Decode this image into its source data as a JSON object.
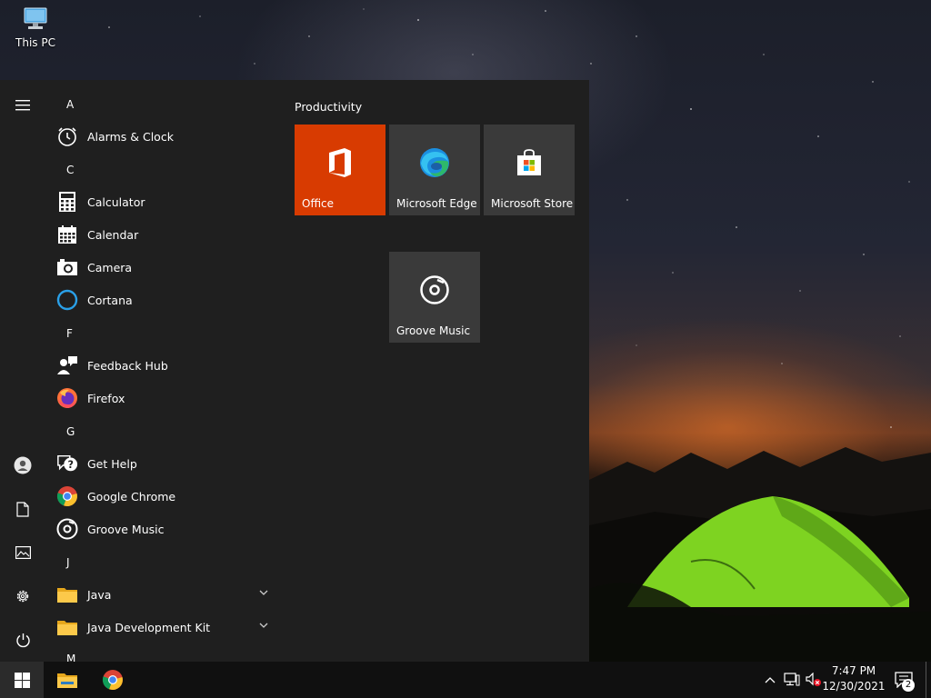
{
  "desktop": {
    "icons": [
      {
        "label": "This PC",
        "icon": "computer-icon"
      }
    ]
  },
  "start_menu": {
    "rail": [
      {
        "icon": "hamburger-menu-icon"
      },
      {
        "icon": "user-account-icon"
      },
      {
        "icon": "documents-icon"
      },
      {
        "icon": "pictures-icon"
      },
      {
        "icon": "settings-gear-icon"
      },
      {
        "icon": "power-icon"
      }
    ],
    "groups": [
      {
        "letter": "A",
        "items": [
          {
            "label": "Alarms & Clock",
            "icon": "alarm-clock-icon"
          }
        ]
      },
      {
        "letter": "C",
        "items": [
          {
            "label": "Calculator",
            "icon": "calculator-icon"
          },
          {
            "label": "Calendar",
            "icon": "calendar-icon"
          },
          {
            "label": "Camera",
            "icon": "camera-icon"
          },
          {
            "label": "Cortana",
            "icon": "cortana-icon"
          }
        ]
      },
      {
        "letter": "F",
        "items": [
          {
            "label": "Feedback Hub",
            "icon": "feedback-hub-icon"
          },
          {
            "label": "Firefox",
            "icon": "firefox-icon"
          }
        ]
      },
      {
        "letter": "G",
        "items": [
          {
            "label": "Get Help",
            "icon": "get-help-icon"
          },
          {
            "label": "Google Chrome",
            "icon": "chrome-icon"
          },
          {
            "label": "Groove Music",
            "icon": "groove-music-icon"
          }
        ]
      },
      {
        "letter": "J",
        "items": [
          {
            "label": "Java",
            "icon": "folder-icon",
            "expandable": true
          },
          {
            "label": "Java Development Kit",
            "icon": "folder-icon",
            "expandable": true
          }
        ]
      },
      {
        "letter": "M",
        "items": []
      }
    ],
    "tiles": {
      "group_title": "Productivity",
      "items": [
        {
          "label": "Office",
          "icon": "office-icon",
          "color": "#d83b01"
        },
        {
          "label": "Microsoft Edge",
          "icon": "edge-icon",
          "color": "#3a3a3a"
        },
        {
          "label": "Microsoft Store",
          "icon": "store-icon",
          "color": "#3a3a3a"
        },
        {
          "label": "Groove Music",
          "icon": "groove-music-icon",
          "color": "#3a3a3a"
        }
      ]
    }
  },
  "taskbar": {
    "pinned": [
      {
        "icon": "windows-start-icon"
      },
      {
        "icon": "file-explorer-icon"
      },
      {
        "icon": "chrome-icon"
      }
    ],
    "tray": [
      {
        "icon": "chevron-up-icon"
      },
      {
        "icon": "network-icon"
      },
      {
        "icon": "volume-muted-icon"
      }
    ],
    "clock": {
      "time": "7:47 PM",
      "date": "12/30/2021"
    },
    "notifications": {
      "count": "2",
      "icon": "action-center-icon"
    }
  },
  "colors": {
    "accent": "#d83b01",
    "menu_bg": "#1f1f1f",
    "tile_bg": "#3a3a3a"
  }
}
